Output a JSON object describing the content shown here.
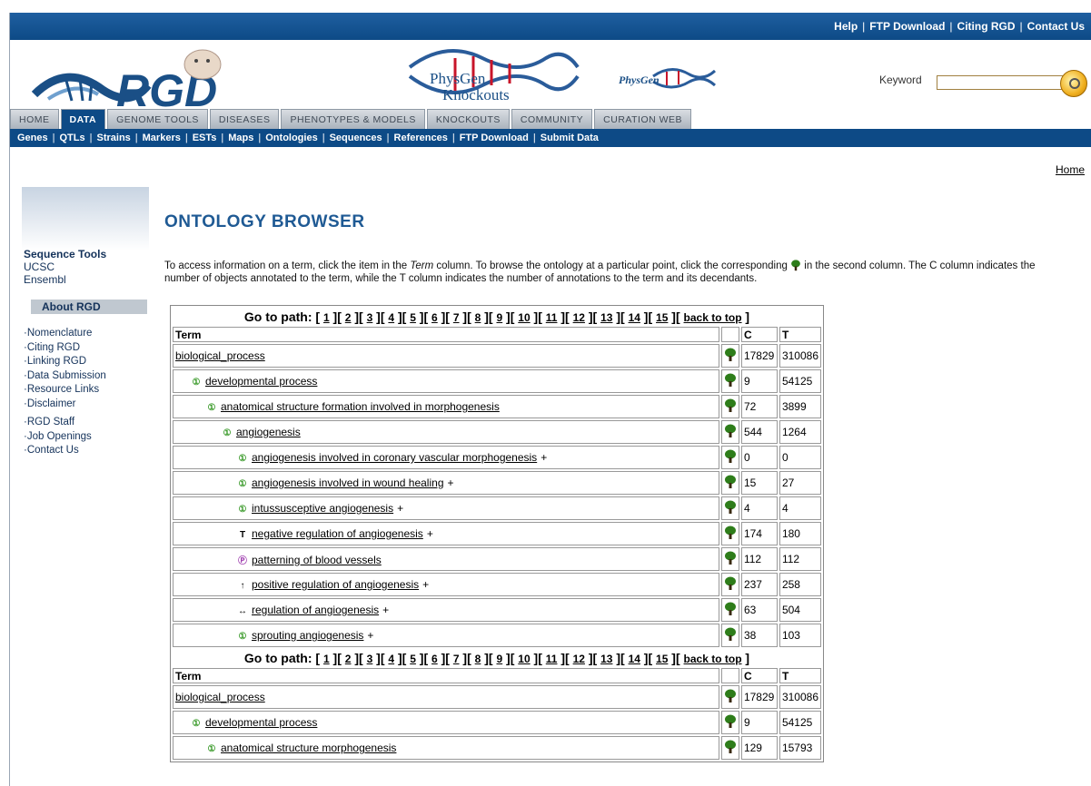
{
  "toplinks": [
    "Help",
    "FTP Download",
    "Citing RGD",
    "Contact Us"
  ],
  "logos": {
    "physgen_text1": "PhysGen",
    "physgen_text2": "Knockouts",
    "physgen_small": "PhysGen"
  },
  "keyword": {
    "label": "Keyword",
    "value": ""
  },
  "tabs": [
    "HOME",
    "DATA",
    "GENOME TOOLS",
    "DISEASES",
    "PHENOTYPES & MODELS",
    "KNOCKOUTS",
    "COMMUNITY",
    "CURATION WEB"
  ],
  "subnav": [
    "Genes",
    "QTLs",
    "Strains",
    "Markers",
    "ESTs",
    "Maps",
    "Ontologies",
    "Sequences",
    "References",
    "FTP Download",
    "Submit Data"
  ],
  "home_link": "Home",
  "sidebar": {
    "seq_title": "Sequence Tools",
    "seq_links": [
      "UCSC",
      "Ensembl"
    ],
    "about_title": "About RGD",
    "about_links": [
      "Nomenclature",
      "Citing RGD",
      "Linking RGD",
      "Data Submission",
      "Resource Links",
      "Disclaimer"
    ],
    "staff_links": [
      "RGD Staff",
      "Job Openings",
      "Contact Us"
    ]
  },
  "page_title": "ONTOLOGY BROWSER",
  "intro": {
    "p1": "To access information on a term, click the item in the ",
    "term_word": "Term",
    "p2": " column. To browse the ontology at a particular point, click the corresponding ",
    "p3": " in the second column. The C column indicates the number of objects annotated to the term, while the T column indicates the number of annotations to the term and its decendants."
  },
  "goto": {
    "label": "Go to path:",
    "paths": [
      "1",
      "2",
      "3",
      "4",
      "5",
      "6",
      "7",
      "8",
      "9",
      "10",
      "11",
      "12",
      "13",
      "14",
      "15"
    ],
    "back": "back to top"
  },
  "headers": {
    "term": "Term",
    "c": "C",
    "t": "T"
  },
  "tree_color": "#2e7d1a",
  "sections": [
    {
      "rows": [
        {
          "indent": 0,
          "mark": "",
          "term": "biological_process",
          "plus": "",
          "c": "17829",
          "t": "310086"
        },
        {
          "indent": 1,
          "mark": "①",
          "markclass": "mk-circle",
          "term": "developmental process",
          "plus": "",
          "c": "9",
          "t": "54125"
        },
        {
          "indent": 2,
          "mark": "①",
          "markclass": "mk-circle",
          "term": "anatomical structure formation involved in morphogenesis",
          "plus": "",
          "c": "72",
          "t": "3899"
        },
        {
          "indent": 3,
          "mark": "①",
          "markclass": "mk-circle",
          "term": "angiogenesis",
          "plus": "",
          "c": "544",
          "t": "1264"
        },
        {
          "indent": 4,
          "mark": "①",
          "markclass": "mk-circle",
          "term": "angiogenesis involved in coronary vascular morphogenesis",
          "plus": "+",
          "c": "0",
          "t": "0"
        },
        {
          "indent": 4,
          "mark": "①",
          "markclass": "mk-circle",
          "term": "angiogenesis involved in wound healing",
          "plus": "+",
          "c": "15",
          "t": "27"
        },
        {
          "indent": 4,
          "mark": "①",
          "markclass": "mk-circle",
          "term": "intussusceptive angiogenesis",
          "plus": "+",
          "c": "4",
          "t": "4"
        },
        {
          "indent": 4,
          "mark": "T",
          "markclass": "",
          "term": "negative regulation of angiogenesis",
          "plus": "+",
          "c": "174",
          "t": "180"
        },
        {
          "indent": 4,
          "mark": "Ⓟ",
          "markclass": "mk-purple",
          "term": "patterning of blood vessels",
          "plus": "",
          "c": "112",
          "t": "112"
        },
        {
          "indent": 4,
          "mark": "↑",
          "markclass": "",
          "term": "positive regulation of angiogenesis",
          "plus": "+",
          "c": "237",
          "t": "258"
        },
        {
          "indent": 4,
          "mark": "↔",
          "markclass": "",
          "term": "regulation of angiogenesis",
          "plus": "+",
          "c": "63",
          "t": "504"
        },
        {
          "indent": 4,
          "mark": "①",
          "markclass": "mk-circle",
          "term": "sprouting angiogenesis",
          "plus": "+",
          "c": "38",
          "t": "103"
        }
      ]
    },
    {
      "rows": [
        {
          "indent": 0,
          "mark": "",
          "term": "biological_process",
          "plus": "",
          "c": "17829",
          "t": "310086"
        },
        {
          "indent": 1,
          "mark": "①",
          "markclass": "mk-circle",
          "term": "developmental process",
          "plus": "",
          "c": "9",
          "t": "54125"
        },
        {
          "indent": 2,
          "mark": "①",
          "markclass": "mk-circle",
          "term": "anatomical structure morphogenesis",
          "plus": "",
          "c": "129",
          "t": "15793"
        }
      ]
    }
  ]
}
